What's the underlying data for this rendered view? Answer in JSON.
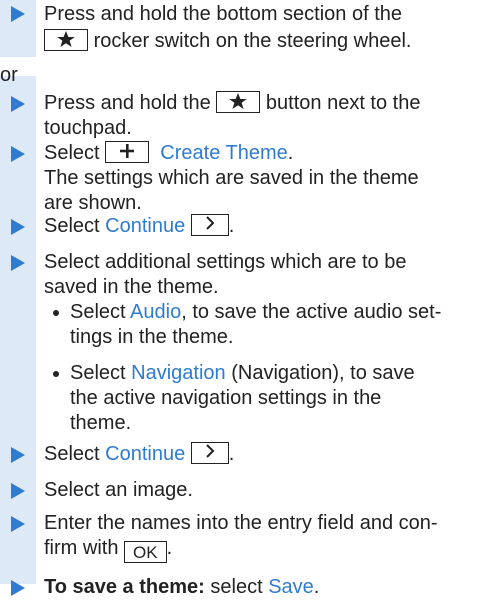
{
  "steps": {
    "s1a": "Press and hold the bottom section of the",
    "s1b": "rocker switch on the steering wheel.",
    "or": "or",
    "s2a": "Press and hold the",
    "s2b": "button next to the",
    "s2c": "touchpad.",
    "s3a": "Select",
    "s3link": "Create Theme",
    "s3b": ".",
    "s3r1": "The settings which are saved in the theme",
    "s3r2": "are shown.",
    "s4a": "Select",
    "s4link": "Continue",
    "s4b": ".",
    "s5l1": "Select additional settings which are to be",
    "s5l2": "saved in the theme.",
    "b1a": "Select",
    "b1link": "Audio",
    "b1b": ", to save the active audio set-",
    "b1c": "tings in the theme.",
    "b2a": "Select",
    "b2link": "Navigation",
    "b2b": "(Navigation), to save",
    "b2c": "the active navigation settings in the",
    "b2d": "theme.",
    "s6a": "Select",
    "s6link": "Continue",
    "s6b": ".",
    "s7": "Select an image.",
    "s8l1": "Enter the names into the entry field and con-",
    "s8l2a": "firm with",
    "s8ok": "OK",
    "s8l2b": ".",
    "s9bold": "To save a theme:",
    "s9a": "select",
    "s9link": "Save",
    "s9b": "."
  },
  "icons": {
    "star": "star-icon",
    "plus": "plus-icon",
    "chevron": "chevron-right-icon",
    "arrow": "triangle-bullet-icon"
  },
  "colors": {
    "link": "#2f7bd0",
    "bullet": "#2f7bd0",
    "band": "#dde9f6"
  }
}
